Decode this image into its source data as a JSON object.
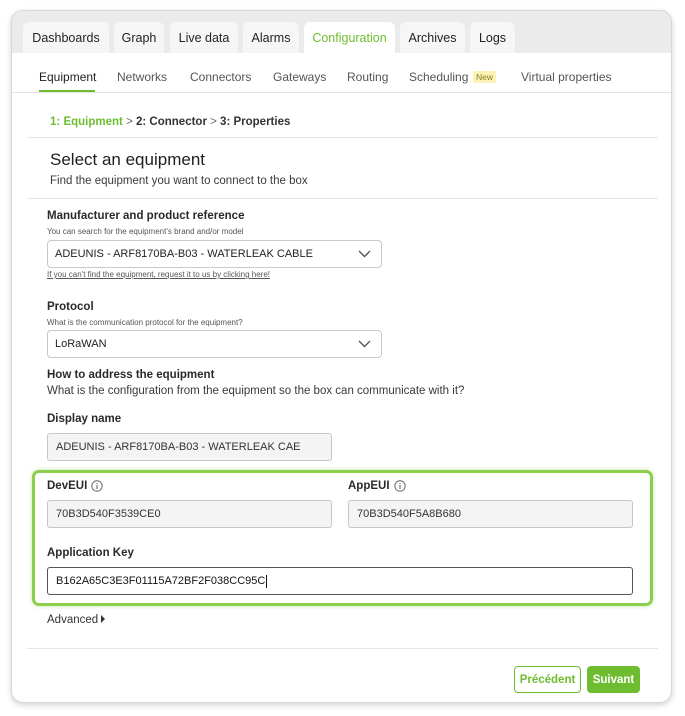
{
  "tabs": [
    "Dashboards",
    "Graph",
    "Live data",
    "Alarms",
    "Configuration",
    "Archives",
    "Logs"
  ],
  "active_tab": "Configuration",
  "subnav": {
    "items": [
      "Equipment",
      "Networks",
      "Connectors",
      "Gateways",
      "Routing",
      "Scheduling",
      "Virtual properties"
    ],
    "new_badge": "New"
  },
  "steps": {
    "step1_num": "1:",
    "step1_label": "Equipment",
    "step2_num": "2:",
    "step2_label": "Connector",
    "step3_num": "3:",
    "step3_label": "Properties",
    "separator": ">"
  },
  "header": {
    "title": "Select an equipment",
    "subtitle": "Find the equipment you want to connect to the box"
  },
  "manufacturer": {
    "label": "Manufacturer and product reference",
    "hint": "You can search for the equipment's brand and/or model",
    "value": "ADEUNIS - ARF8170BA-B03 - WATERLEAK CABLE",
    "link": "If you can't find the equipment, request it to us by clicking here!"
  },
  "protocol": {
    "label": "Protocol",
    "hint": "What is the communication protocol for the equipment?",
    "value": "LoRaWAN"
  },
  "addressing": {
    "label": "How to address the equipment",
    "description": "What is the configuration from the equipment so the box can communicate with it?"
  },
  "display_name": {
    "label": "Display name",
    "value": "ADEUNIS - ARF8170BA-B03 - WATERLEAK CAE"
  },
  "dev_eui": {
    "label": "DevEUI",
    "value": "70B3D540F3539CE0"
  },
  "app_eui": {
    "label": "AppEUI",
    "value": "70B3D540F5A8B680"
  },
  "app_key": {
    "label": "Application Key",
    "value": "B162A65C3E3F01115A72BF2F038CC95C"
  },
  "advanced_label": "Advanced",
  "buttons": {
    "previous": "Précédent",
    "next": "Suivant"
  },
  "colors": {
    "accent": "#6ebd30",
    "highlight": "#8ccf4f"
  }
}
